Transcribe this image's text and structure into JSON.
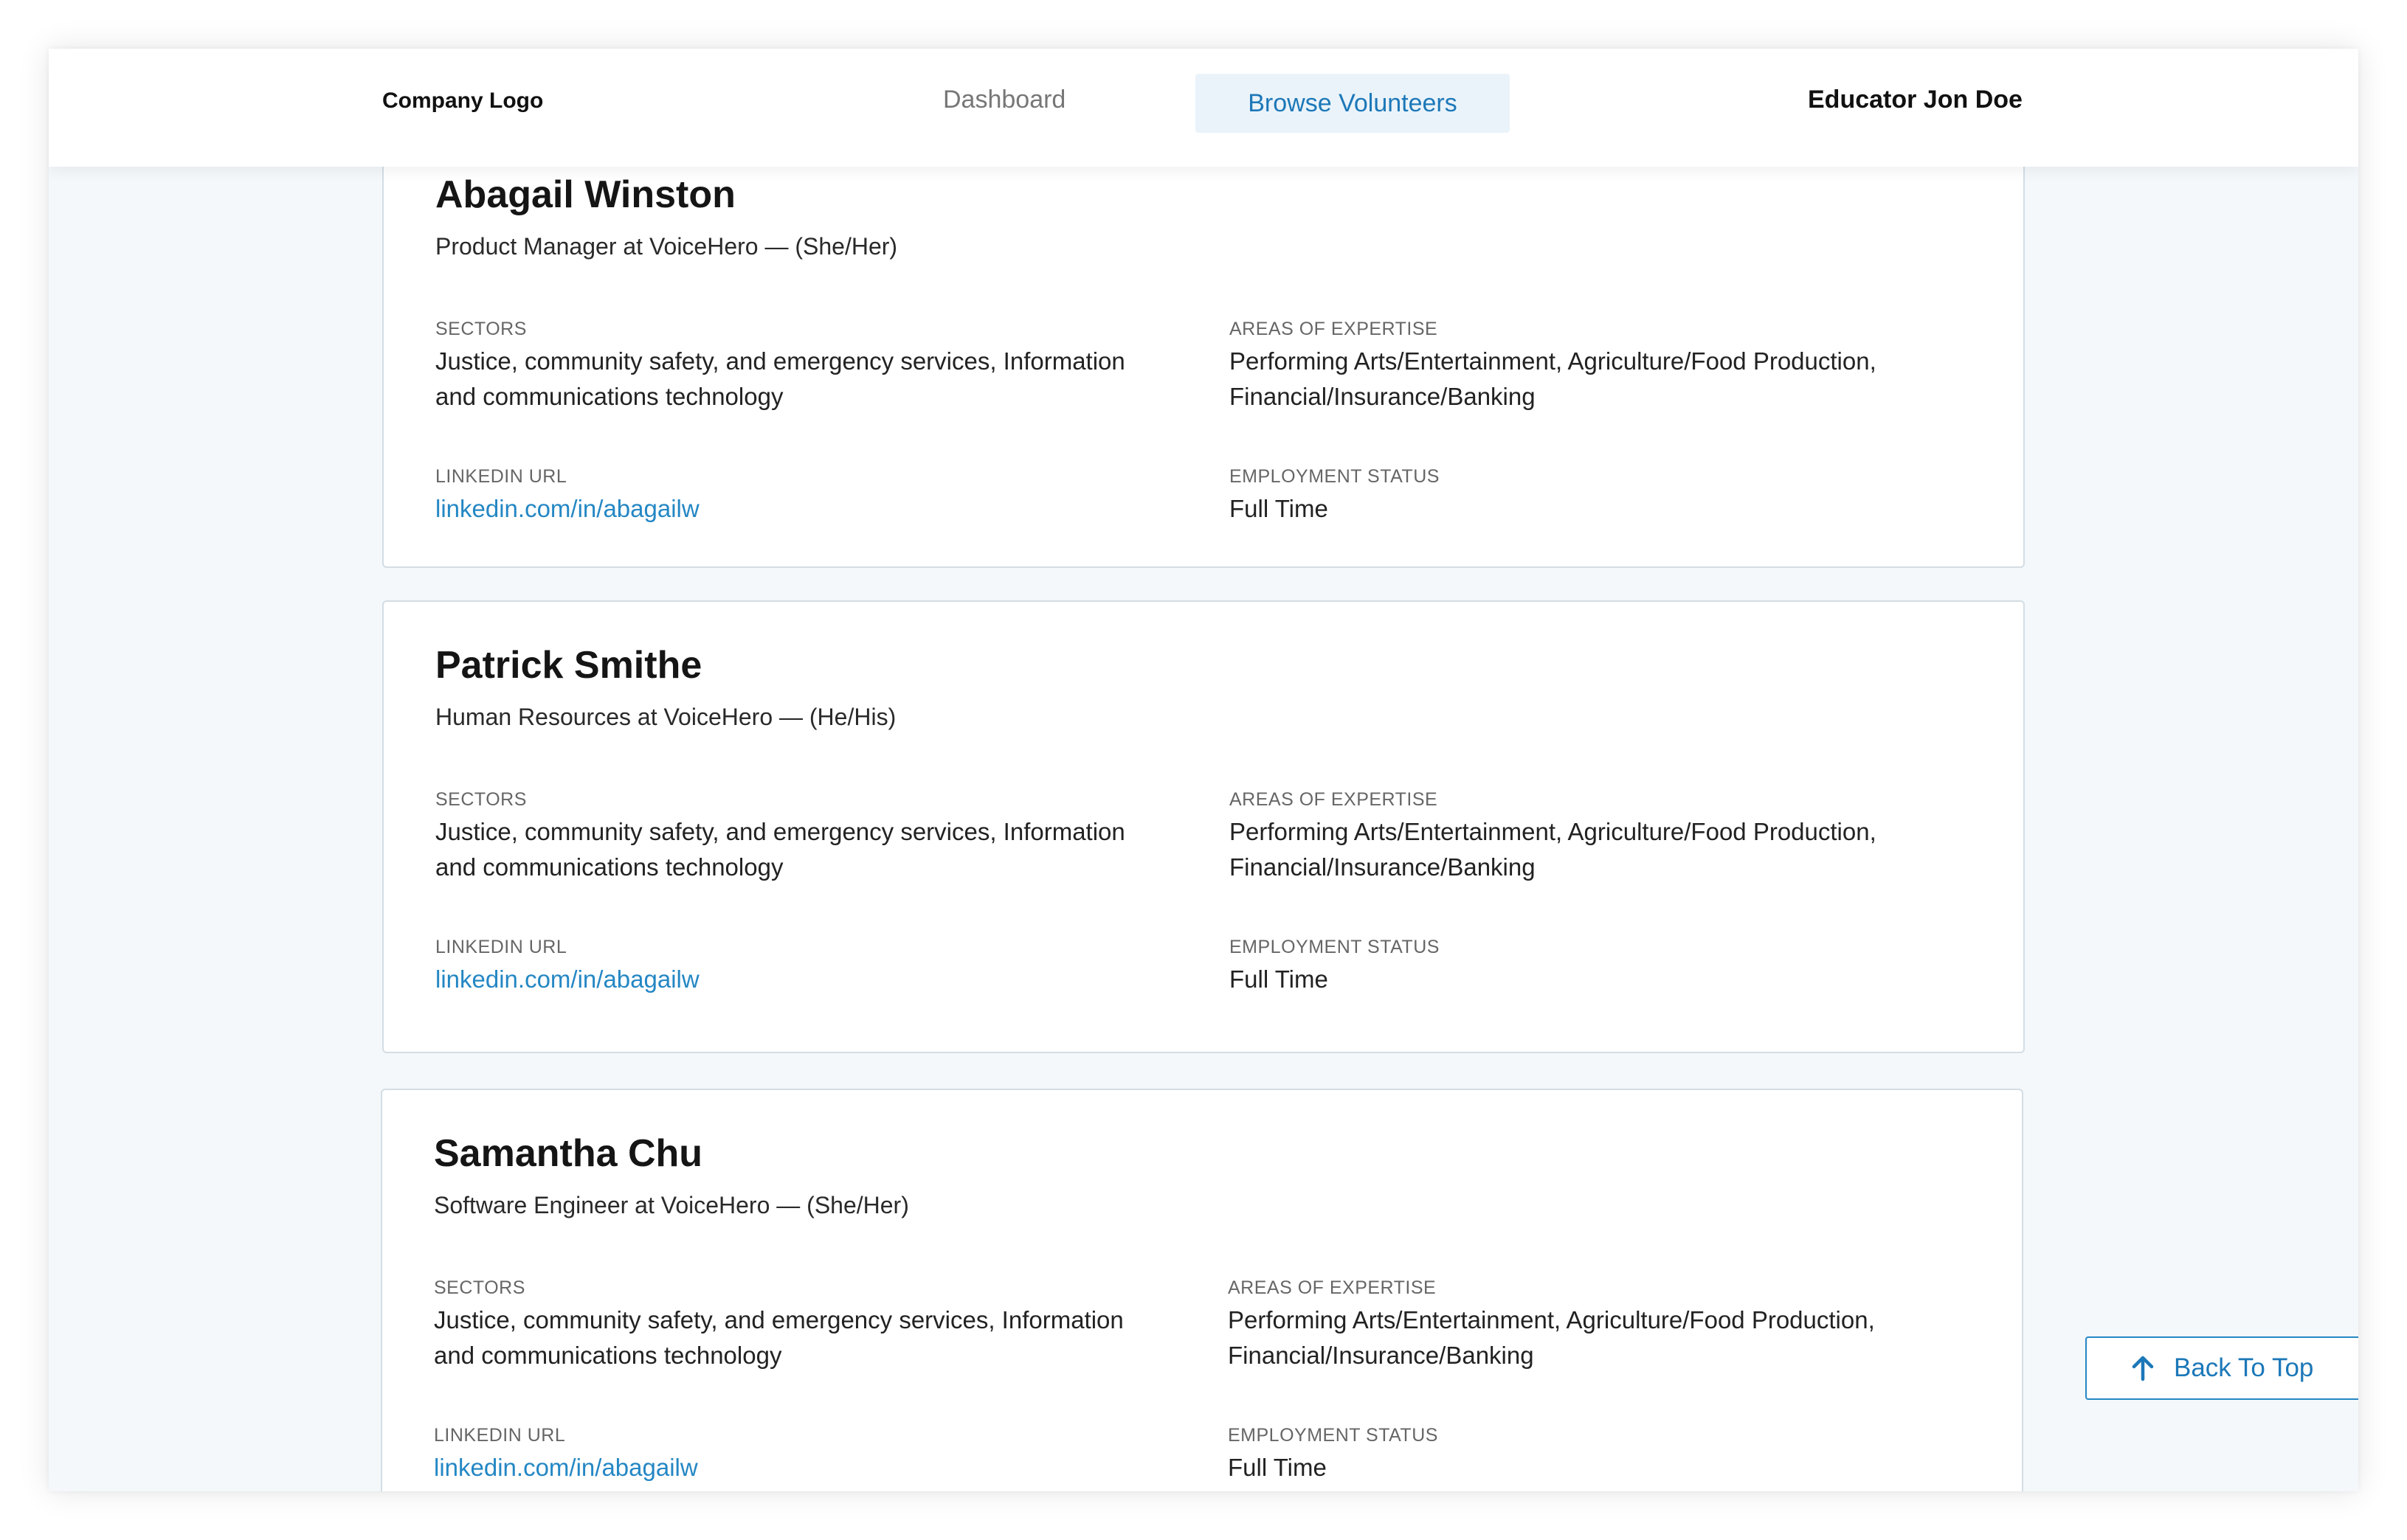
{
  "header": {
    "logo": "Company Logo",
    "nav": {
      "dashboard": "Dashboard",
      "browse": "Browse Volunteers"
    },
    "user": "Educator Jon Doe"
  },
  "labels": {
    "sectors": "SECTORS",
    "expertise": "AREAS OF EXPERTISE",
    "linkedin": "LINKEDIN URL",
    "employment": "EMPLOYMENT STATUS"
  },
  "volunteers": [
    {
      "name": "Abagail Winston",
      "subtitle": "Product Manager at VoiceHero — (She/Her)",
      "sectors_line1": "Justice, community safety, and emergency services, Information",
      "sectors_line2": "and communications technology",
      "expertise_line1": "Performing Arts/Entertainment, Agriculture/Food Production,",
      "expertise_line2": "Financial/Insurance/Banking",
      "linkedin": "linkedin.com/in/abagailw",
      "employment": "Full Time"
    },
    {
      "name": "Patrick Smithe",
      "subtitle": "Human Resources at VoiceHero — (He/His)",
      "sectors_line1": "Justice, community safety, and emergency services, Information",
      "sectors_line2": "and communications technology",
      "expertise_line1": "Performing Arts/Entertainment, Agriculture/Food Production,",
      "expertise_line2": "Financial/Insurance/Banking",
      "linkedin": "linkedin.com/in/abagailw",
      "employment": "Full Time"
    },
    {
      "name": "Samantha Chu",
      "subtitle": "Software Engineer at VoiceHero — (She/Her)",
      "sectors_line1": "Justice, community safety, and emergency services, Information",
      "sectors_line2": "and communications technology",
      "expertise_line1": "Performing Arts/Entertainment, Agriculture/Food Production,",
      "expertise_line2": "Financial/Insurance/Banking",
      "linkedin": "linkedin.com/in/abagailw",
      "employment": "Full Time"
    }
  ],
  "back_to_top": {
    "label": "Back To Top",
    "icon": "arrow-up-icon"
  },
  "colors": {
    "accent": "#2487c4",
    "page_background": "#f4f8fb",
    "nav_active_background": "#eaf3fa"
  }
}
